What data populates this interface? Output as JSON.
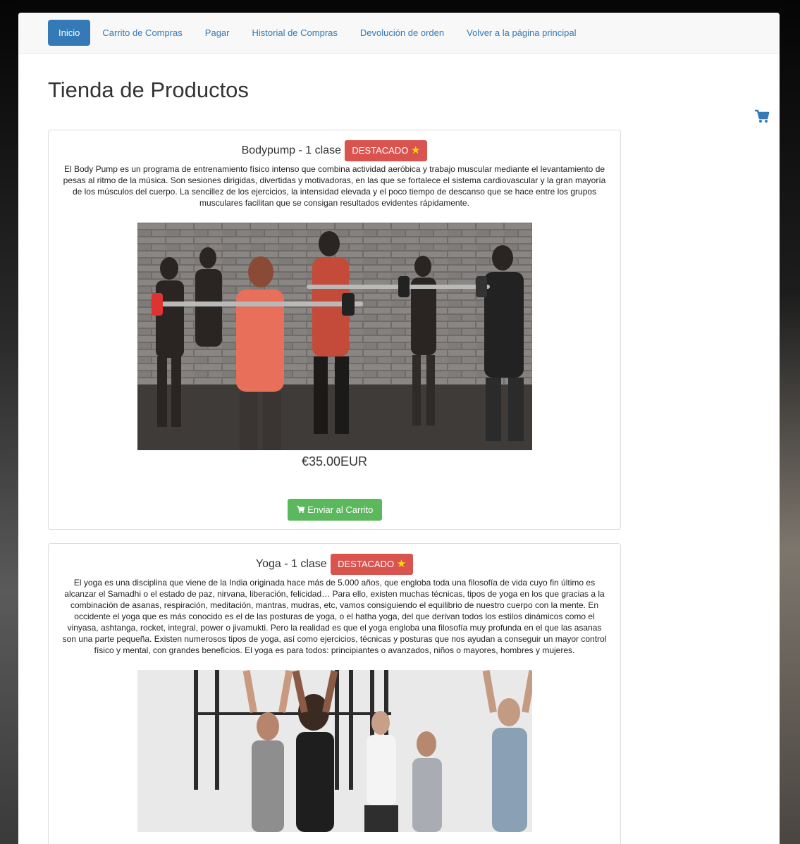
{
  "nav": {
    "items": [
      {
        "label": "Inicio",
        "active": true
      },
      {
        "label": "Carrito de Compras",
        "active": false
      },
      {
        "label": "Pagar",
        "active": false
      },
      {
        "label": "Historial de Compras",
        "active": false
      },
      {
        "label": "Devolución de orden",
        "active": false
      },
      {
        "label": "Volver a la página principal",
        "active": false
      }
    ]
  },
  "page": {
    "title": "Tienda de Productos",
    "cart_icon": "shopping-cart-icon"
  },
  "products": [
    {
      "name": "Bodypump - 1 clase",
      "badge": "DESTACADO",
      "badge_icon": "★",
      "description": "El Body Pump es un programa de entrenamiento físico intenso que combina actividad aeróbica y trabajo muscular mediante el levantamiento de pesas al ritmo de la música. Son sesiones dirigidas, divertidas y motivadoras, en las que se fortalece el sistema cardiovascular y la gran mayoría de los músculos del cuerpo. La sencillez de los ejercicios, la intensidad elevada y el poco tiempo de descanso que se hace entre los grupos musculares facilitan que se consigan resultados evidentes rápidamente.",
      "price": "€35.00EUR",
      "button_label": "Enviar al Carrito"
    },
    {
      "name": "Yoga - 1 clase",
      "badge": "DESTACADO",
      "badge_icon": "★",
      "description": "El yoga es una disciplina que viene de la India originada hace más de 5.000 años, que engloba toda una filosofía de vida cuyo fin último es alcanzar el Samadhi o el estado de paz, nirvana, liberación, felicidad… Para ello, existen muchas técnicas, tipos de yoga en los que gracias a la combinación de asanas, respiración, meditación, mantras, mudras, etc, vamos consiguiendo el equilibrio de nuestro cuerpo con la mente. En occidente el yoga que es más conocido es el de las posturas de yoga, o el hatha yoga, del que derivan todos los estilos dinámicos como el vinyasa, ashtanga, rocket, integral, power o jivamukti. Pero la realidad es que el yoga engloba una filosofía muy profunda en el que las asanas son una parte pequeña. Existen numerosos tipos de yoga, así como ejercicios, técnicas y posturas que nos ayudan a conseguir un mayor control físico y mental, con grandes beneficios. El yoga es para todos: principiantes o avanzados, niños o mayores, hombres y mujeres."
    }
  ],
  "colors": {
    "nav_active": "#337ab7",
    "badge": "#d9534f",
    "button": "#5cb85c",
    "link": "#337ab7"
  }
}
